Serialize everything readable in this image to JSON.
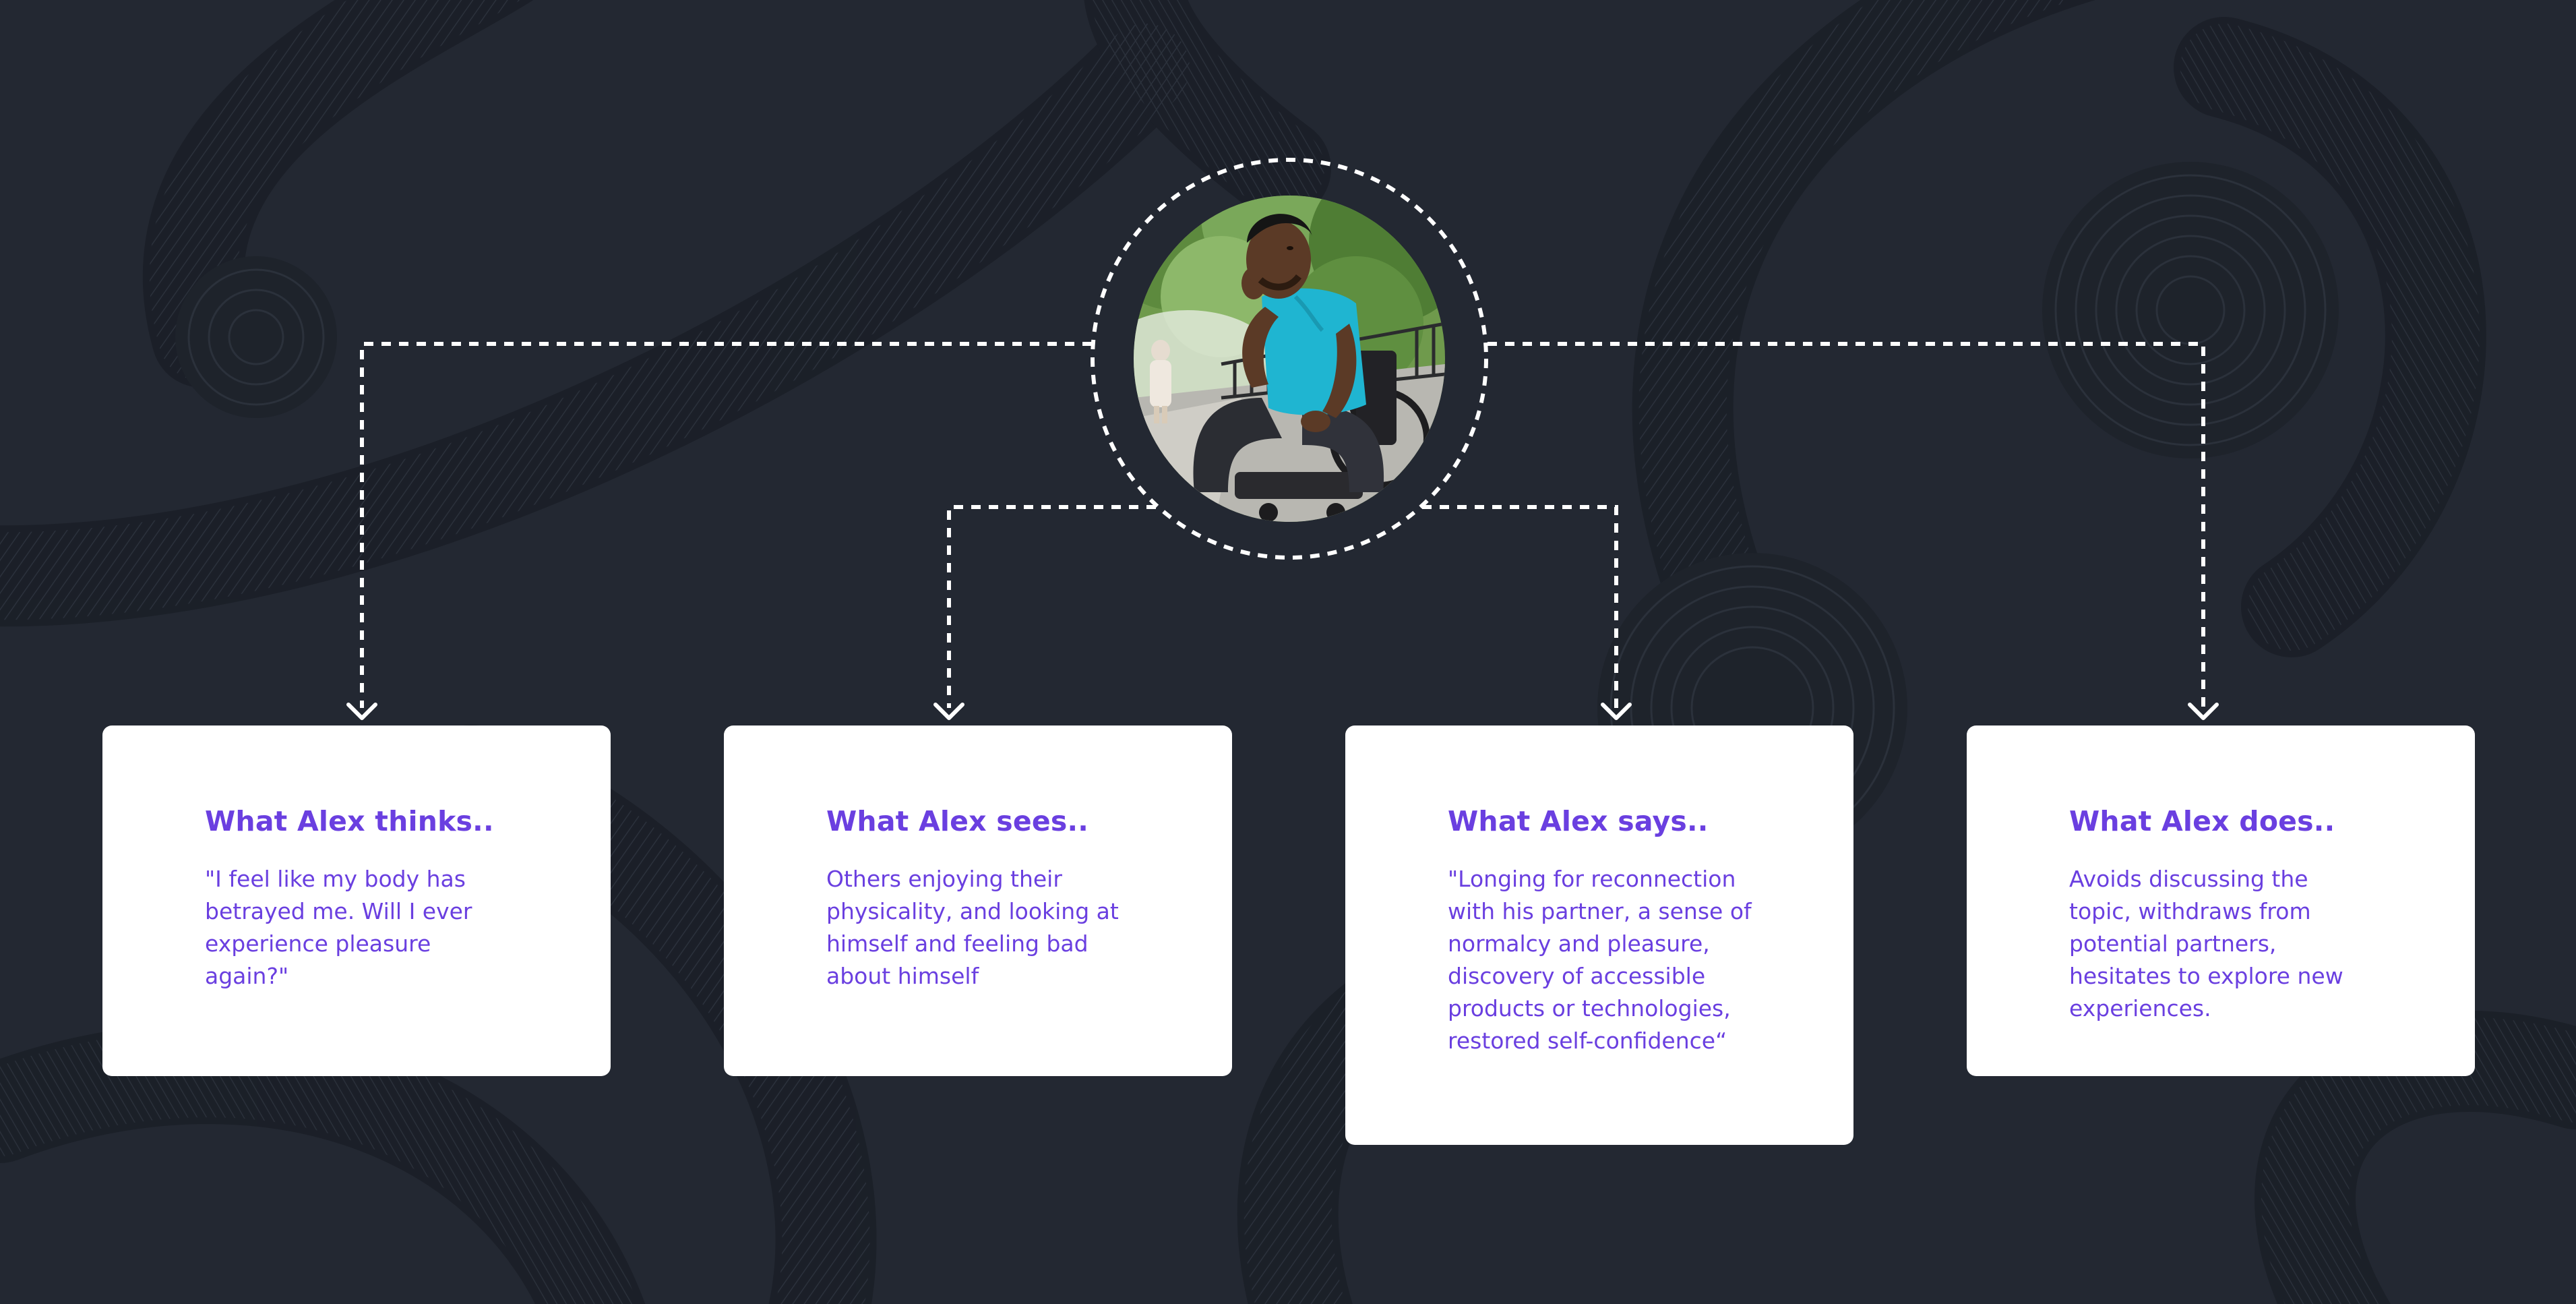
{
  "persona": {
    "photo_alt": "Young man in turquoise t-shirt sitting in a wheelchair on a park path, resting his chin on his hand"
  },
  "cards": [
    {
      "title": "What Alex thinks..",
      "body": "\"I feel like my body has betrayed me. Will I ever experience pleasure again?\""
    },
    {
      "title": "What Alex sees..",
      "body": "Others enjoying their physicality, and looking at himself and feeling bad about himself"
    },
    {
      "title": "What Alex says..",
      "body": "\"Longing for reconnection with his partner, a sense of normalcy and pleasure, discovery of accessible products or technologies, restored self-confidence“"
    },
    {
      "title": "What Alex does..",
      "body": "Avoids discussing the topic, withdraws from potential partners, hesitates to explore new experiences."
    }
  ],
  "colors": {
    "background": "#232832",
    "accent": "#6a3fe0",
    "card": "#ffffff",
    "connector": "#ffffff"
  }
}
